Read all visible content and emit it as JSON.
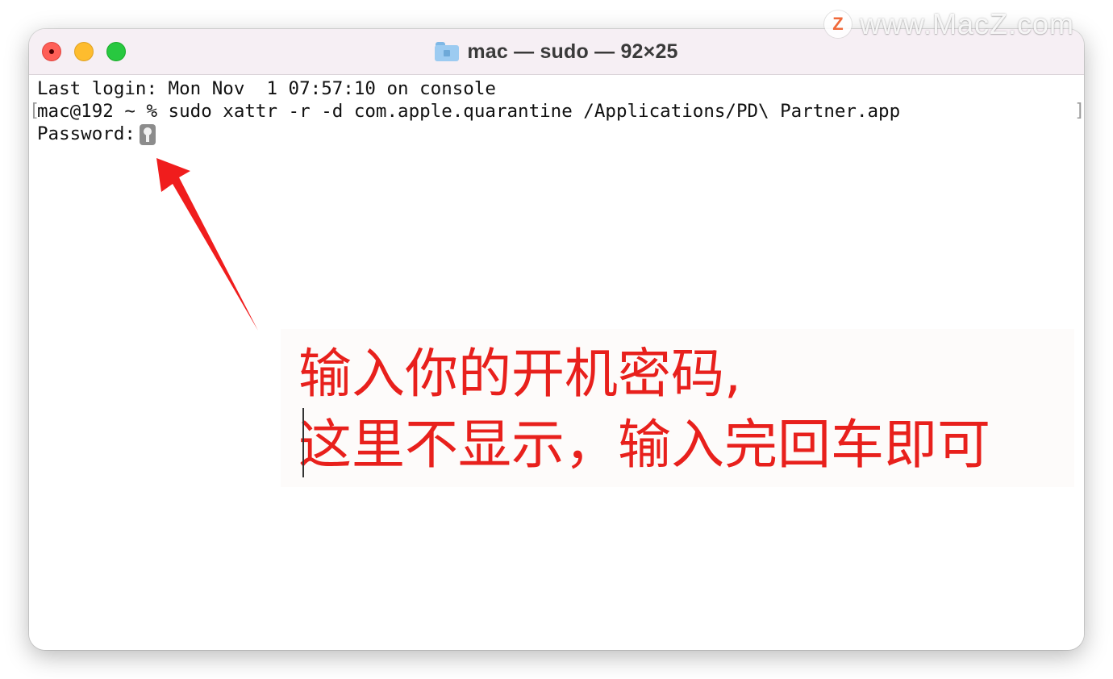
{
  "window": {
    "title": "mac — sudo — 92×25",
    "folder_icon": "home-folder-icon",
    "traffic_lights": {
      "close_color": "#fe5f57",
      "minimize_color": "#febc2e",
      "zoom_color": "#28c840"
    }
  },
  "terminal": {
    "lines": [
      "Last login: Mon Nov  1 07:57:10 on console",
      "mac@192 ~ % sudo xattr -r -d com.apple.quarantine /Applications/PD\\ Partner.app",
      "Password:"
    ],
    "mark_left": "[",
    "mark_right": "]",
    "password_icon": "key-icon"
  },
  "annotation": {
    "line1": "输入你的开机密码,",
    "line2": "这里不显示，输入完回车即可",
    "color": "#e8201c",
    "arrow_icon": "red-arrow-icon"
  },
  "watermark": {
    "logo_letter": "Z",
    "text": "www.MacZ.com"
  }
}
